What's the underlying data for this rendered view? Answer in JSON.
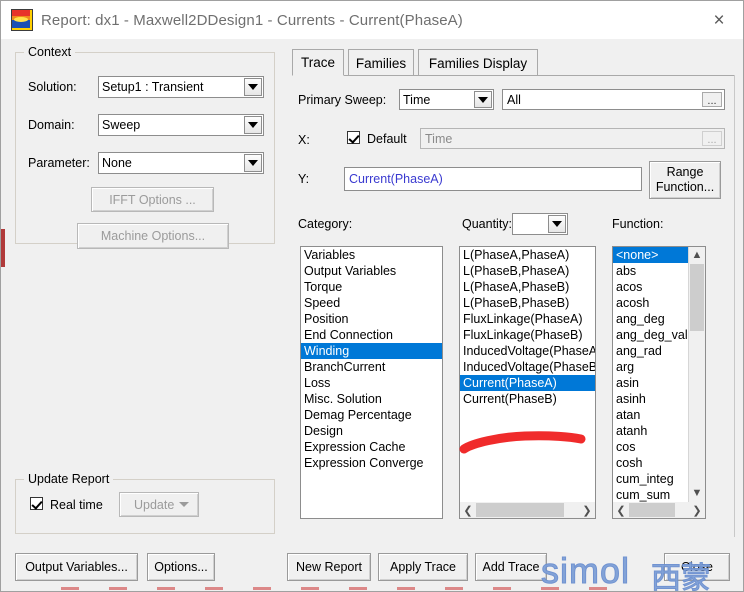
{
  "window": {
    "title": "Report: dx1 - Maxwell2DDesign1 - Currents - Current(PhaseA)",
    "close_label": "×",
    "icon": "maxwell-app-icon",
    "accent_selection_color": "#0078d7",
    "expression_text_color": "#3a3ad0"
  },
  "context": {
    "group_label": "Context",
    "solution_label": "Solution:",
    "solution_value": "Setup1 : Transient",
    "domain_label": "Domain:",
    "domain_value": "Sweep",
    "parameter_label": "Parameter:",
    "parameter_value": "None",
    "ifft_button": "IFFT Options ...",
    "machine_button": "Machine Options..."
  },
  "update_report": {
    "group_label": "Update Report",
    "realtime_label": "Real time",
    "realtime_checked": true,
    "update_button": "Update"
  },
  "left_buttons": {
    "output_variables": "Output Variables...",
    "options": "Options..."
  },
  "tabs": [
    {
      "label": "Trace",
      "active": true
    },
    {
      "label": "Families",
      "active": false
    },
    {
      "label": "Families Display",
      "active": false
    }
  ],
  "trace": {
    "primary_sweep_label": "Primary Sweep:",
    "primary_sweep_value": "Time",
    "primary_sweep_range": "All",
    "x_label": "X:",
    "x_default_label": "Default",
    "x_default_checked": true,
    "x_value": "Time",
    "y_label": "Y:",
    "y_value": "Current(PhaseA)",
    "range_function_button": "Range\nFunction...",
    "range_function_line1": "Range",
    "range_function_line2": "Function...",
    "category_label": "Category:",
    "quantity_label": "Quantity:",
    "quantity_combo_value": "",
    "function_label": "Function:"
  },
  "category_list": {
    "items": [
      "Variables",
      "Output Variables",
      "Torque",
      "Speed",
      "Position",
      "End Connection",
      "Winding",
      "BranchCurrent",
      "Loss",
      "Misc. Solution",
      "Demag Percentage",
      "Design",
      "Expression Cache",
      "Expression Converge"
    ],
    "selected": "Winding"
  },
  "quantity_list": {
    "items": [
      "L(PhaseA,PhaseA)",
      "L(PhaseB,PhaseA)",
      "L(PhaseA,PhaseB)",
      "L(PhaseB,PhaseB)",
      "FluxLinkage(PhaseA)",
      "FluxLinkage(PhaseB)",
      "InducedVoltage(PhaseA)",
      "InducedVoltage(PhaseB)",
      "Current(PhaseA)",
      "Current(PhaseB)"
    ],
    "selected": "Current(PhaseA)"
  },
  "function_list": {
    "items": [
      "<none>",
      "abs",
      "acos",
      "acosh",
      "ang_deg",
      "ang_deg_val",
      "ang_rad",
      "arg",
      "asin",
      "asinh",
      "atan",
      "atanh",
      "cos",
      "cosh",
      "cum_integ",
      "cum_sum"
    ],
    "selected": "<none>"
  },
  "bottom_buttons": {
    "new_report": "New Report",
    "apply_trace": "Apply Trace",
    "add_trace": "Add Trace",
    "close": "Close"
  },
  "annotations": {
    "watermark_latin": "simol",
    "watermark_cjk": "西蒙",
    "red_underline_present": true
  }
}
